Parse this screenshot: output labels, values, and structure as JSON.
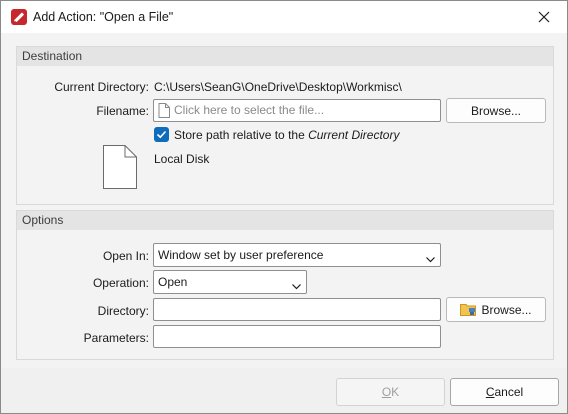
{
  "window": {
    "title": "Add Action: \"Open a File\"",
    "app_icon": "pdf-app-icon",
    "close_icon": "close-icon"
  },
  "destination": {
    "header": "Destination",
    "current_directory_label": "Current Directory:",
    "current_directory_value": "C:\\Users\\SeanG\\OneDrive\\Desktop\\Workmisc\\",
    "filename_label": "Filename:",
    "filename_placeholder": "Click here to select the file...",
    "browse_label": "Browse...",
    "store_path_label": "Store path relative to the",
    "store_path_emphasis": "Current Directory",
    "store_path_checked": true,
    "location_icon": "file-icon",
    "location_label": "Local Disk"
  },
  "options": {
    "header": "Options",
    "open_in_label": "Open In:",
    "open_in_value": "Window set by user preference",
    "operation_label": "Operation:",
    "operation_value": "Open",
    "directory_label": "Directory:",
    "directory_value": "",
    "directory_browse_label": "Browse...",
    "directory_browse_icon": "folder-icon",
    "parameters_label": "Parameters:",
    "parameters_value": ""
  },
  "footer": {
    "ok_label": "OK",
    "ok_enabled": false,
    "cancel_label": "Cancel"
  },
  "colors": {
    "accent": "#0f6cbd",
    "app_icon_red": "#c7282d"
  }
}
